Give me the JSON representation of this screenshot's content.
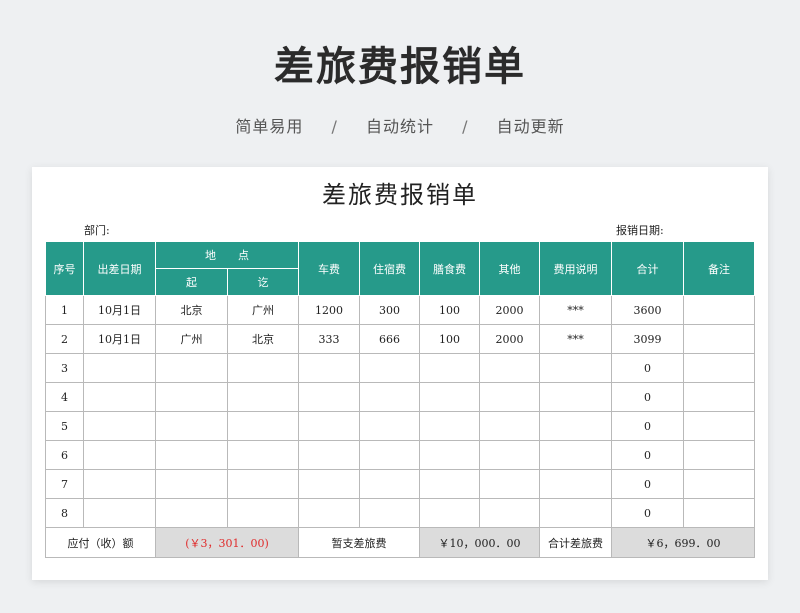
{
  "hero": {
    "title": "差旅费报销单",
    "tags": [
      "简单易用",
      "自动统计",
      "自动更新"
    ],
    "separator": "/"
  },
  "sheet": {
    "title": "差旅费报销单",
    "department_label": "部门:",
    "date_label": "报销日期:"
  },
  "table": {
    "headers": {
      "seq": "序号",
      "date": "出差日期",
      "place": "地　　点",
      "from": "起",
      "to": "讫",
      "car": "车费",
      "hotel": "住宿费",
      "meal": "膳食费",
      "other": "其他",
      "desc": "费用说明",
      "total": "合计",
      "note": "备注"
    },
    "rows": [
      {
        "seq": "1",
        "date": "10月1日",
        "from": "北京",
        "to": "广州",
        "car": "1200",
        "hotel": "300",
        "meal": "100",
        "other": "2000",
        "desc": "***",
        "total": "3600",
        "note": ""
      },
      {
        "seq": "2",
        "date": "10月1日",
        "from": "广州",
        "to": "北京",
        "car": "333",
        "hotel": "666",
        "meal": "100",
        "other": "2000",
        "desc": "***",
        "total": "3099",
        "note": ""
      },
      {
        "seq": "3",
        "date": "",
        "from": "",
        "to": "",
        "car": "",
        "hotel": "",
        "meal": "",
        "other": "",
        "desc": "",
        "total": "0",
        "note": ""
      },
      {
        "seq": "4",
        "date": "",
        "from": "",
        "to": "",
        "car": "",
        "hotel": "",
        "meal": "",
        "other": "",
        "desc": "",
        "total": "0",
        "note": ""
      },
      {
        "seq": "5",
        "date": "",
        "from": "",
        "to": "",
        "car": "",
        "hotel": "",
        "meal": "",
        "other": "",
        "desc": "",
        "total": "0",
        "note": ""
      },
      {
        "seq": "6",
        "date": "",
        "from": "",
        "to": "",
        "car": "",
        "hotel": "",
        "meal": "",
        "other": "",
        "desc": "",
        "total": "0",
        "note": ""
      },
      {
        "seq": "7",
        "date": "",
        "from": "",
        "to": "",
        "car": "",
        "hotel": "",
        "meal": "",
        "other": "",
        "desc": "",
        "total": "0",
        "note": ""
      },
      {
        "seq": "8",
        "date": "",
        "from": "",
        "to": "",
        "car": "",
        "hotel": "",
        "meal": "",
        "other": "",
        "desc": "",
        "total": "0",
        "note": ""
      }
    ],
    "footer": {
      "payable_label": "应付（收）额",
      "payable_value": "(￥3，301．00)",
      "advance_label": "暂支差旅费",
      "advance_value": "￥10，000．00",
      "sum_label": "合计差旅费",
      "sum_value": "￥6，699．00"
    }
  },
  "colors": {
    "header_bg": "#269a8a",
    "negative": "#e02b2b",
    "summary_bg": "#dcdcdc"
  }
}
